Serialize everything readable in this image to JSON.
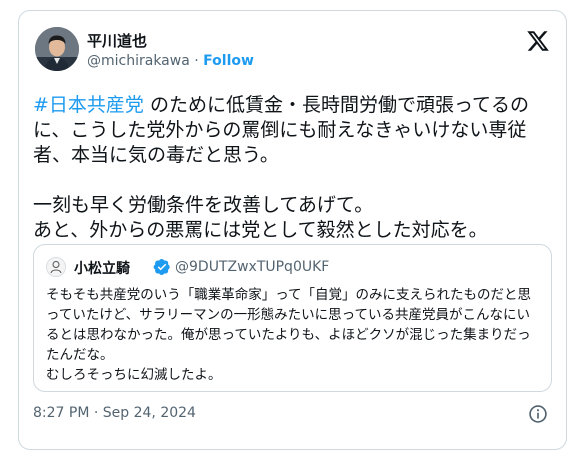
{
  "author": {
    "name": "平川道也",
    "handle": "@michirakawa",
    "separator": "·",
    "follow_label": "Follow"
  },
  "tweet": {
    "hashtag": "#日本共産党",
    "text": " のために低賃金・長時間労働で頑張ってるのに、こうした党外からの罵倒にも耐えなきゃいけない専従者、本当に気の毒だと思う。\n\n一刻も早く労働条件を改善してあげて。\nあと、外からの悪罵には党として毅然とした対応を。",
    "timestamp": "8:27 PM · Sep 24, 2024"
  },
  "quoted": {
    "name": "小松立騎",
    "handle": "@9DUTZwxTUPq0UKF",
    "text": "そもそも共産党のいう「職業革命家」って「自覚」のみに支えられたものだと思っていたけど、サラリーマンの一形態みたいに思っている共産党員がこんなにいるとは思わなかった。俺が思っていたよりも、よほどクソが混じった集まりだったんだな。\nむしろそっちに幻滅したよ。"
  },
  "icons": {
    "platform_logo": "x-logo-icon",
    "verified_badge": "verified-badge-icon",
    "info": "info-icon"
  },
  "colors": {
    "link": "#1d9bf0",
    "text": "#0f1419",
    "secondary": "#536471",
    "border": "#cfd9de"
  }
}
